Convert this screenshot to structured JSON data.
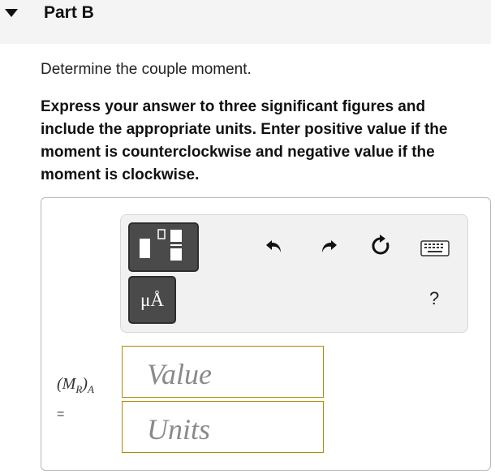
{
  "part": {
    "title": "Part B"
  },
  "question": "Determine the couple moment.",
  "instruction": "Express your answer to three significant figures and include the appropriate units. Enter positive value if the moment is counterclockwise and negative value if the moment is clockwise.",
  "toolbar": {
    "templates_icon": "fraction-template-icon",
    "units_label": "μÅ",
    "undo_icon": "undo-icon",
    "redo_icon": "redo-icon",
    "reset_icon": "reset-icon",
    "keyboard_icon": "keyboard-icon",
    "help_label": "?"
  },
  "answer": {
    "variable": "M",
    "variable_sub": "R",
    "variable_outer_sub": "A",
    "equals": "=",
    "value_placeholder": "Value",
    "units_placeholder": "Units"
  },
  "colors": {
    "header_bg": "#f4f4f4",
    "tool_button_bg": "#4a4a4a",
    "field_border": "#b08a00"
  }
}
